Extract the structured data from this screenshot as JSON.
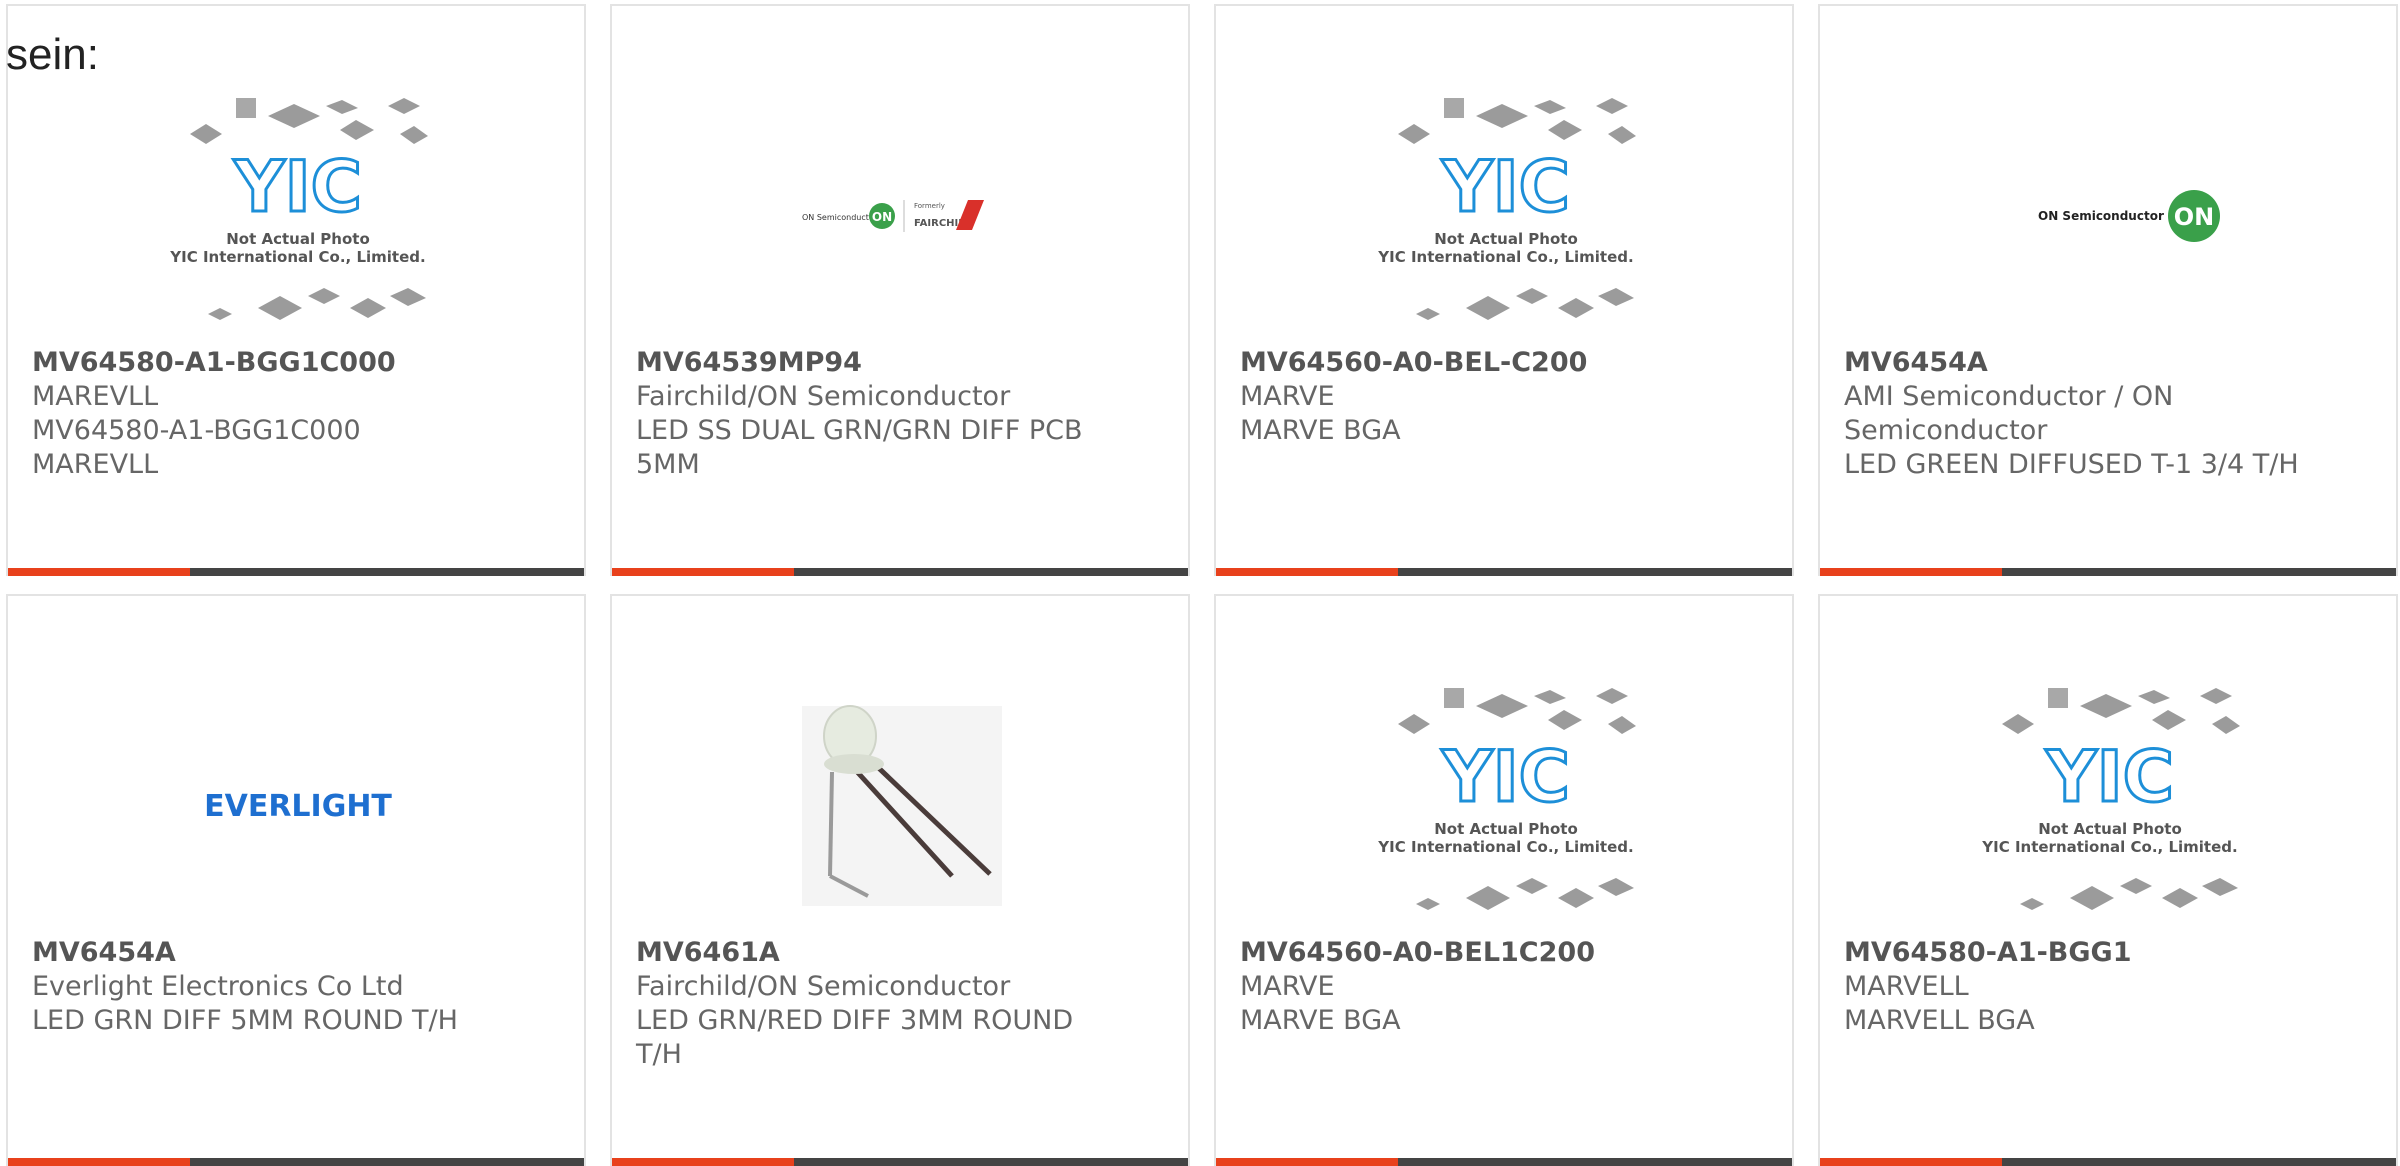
{
  "intro": {
    "text": "sein:"
  },
  "colors": {
    "accent": "#e8411c",
    "bar": "#444444",
    "yic_blue": "#1d8fd8"
  },
  "placeholder": {
    "line1": "Not Actual Photo",
    "line2": "YIC International Co., Limited."
  },
  "logos": {
    "on_small": "ON Semiconductor",
    "formerly": "Formerly",
    "fairchild": "FAIRCHILD",
    "on_badge": "ON",
    "everlight": "EVERLIGHT"
  },
  "cards": [
    {
      "part_number": "MV64580-A1-BGG1C000",
      "manufacturer": "MAREVLL",
      "description": "MV64580-A1-BGG1C000 MAREVLL",
      "image": "yic-placeholder"
    },
    {
      "part_number": "MV64539MP94",
      "manufacturer": "Fairchild/ON Semiconductor",
      "description": "LED SS DUAL GRN/GRN DIFF PCB 5MM",
      "image": "fairchild-on-logo"
    },
    {
      "part_number": "MV64560-A0-BEL-C200",
      "manufacturer": "MARVE",
      "description": "MARVE BGA",
      "image": "yic-placeholder"
    },
    {
      "part_number": "MV6454A",
      "manufacturer": "AMI Semiconductor / ON Semiconductor",
      "description": "LED GREEN DIFFUSED T-1 3/4 T/H",
      "image": "on-semiconductor-logo"
    },
    {
      "part_number": "MV6454A",
      "manufacturer": "Everlight Electronics Co Ltd",
      "description": "LED GRN DIFF 5MM ROUND T/H",
      "image": "everlight-logo"
    },
    {
      "part_number": "MV6461A",
      "manufacturer": "Fairchild/ON Semiconductor",
      "description": "LED GRN/RED DIFF 3MM ROUND T/H",
      "image": "led-photo"
    },
    {
      "part_number": "MV64560-A0-BEL1C200",
      "manufacturer": "MARVE",
      "description": "MARVE BGA",
      "image": "yic-placeholder"
    },
    {
      "part_number": "MV64580-A1-BGG1",
      "manufacturer": "MARVELL",
      "description": "MARVELL BGA",
      "image": "yic-placeholder"
    }
  ]
}
